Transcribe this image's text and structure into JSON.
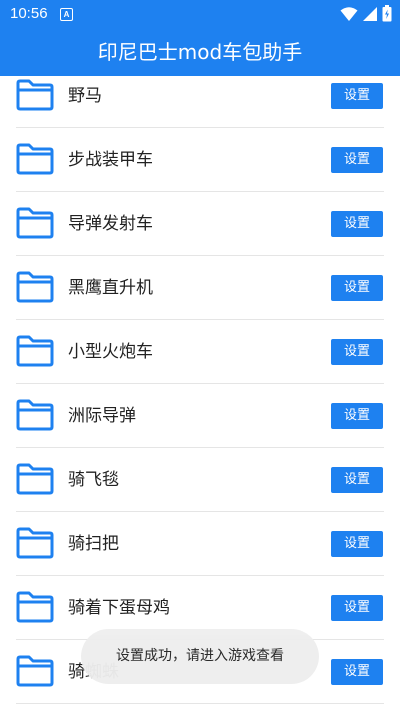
{
  "status_bar": {
    "time": "10:56",
    "notification_icon": "A"
  },
  "app": {
    "title": "印尼巴士mod车包助手"
  },
  "list": {
    "items": [
      {
        "label": "野马",
        "button": "设置"
      },
      {
        "label": "步战装甲车",
        "button": "设置"
      },
      {
        "label": "导弹发射车",
        "button": "设置"
      },
      {
        "label": "黑鹰直升机",
        "button": "设置"
      },
      {
        "label": "小型火炮车",
        "button": "设置"
      },
      {
        "label": "洲际导弹",
        "button": "设置"
      },
      {
        "label": "骑飞毯",
        "button": "设置"
      },
      {
        "label": "骑扫把",
        "button": "设置"
      },
      {
        "label": "骑着下蛋母鸡",
        "button": "设置"
      },
      {
        "label": "骑蜘蛛",
        "button": "设置"
      }
    ]
  },
  "toast": {
    "message": "设置成功，请进入游戏查看"
  },
  "colors": {
    "primary": "#1e81f0",
    "folder_icon": "#1e81f0",
    "divider": "#e5e5e5",
    "text": "#222222"
  },
  "icons": [
    "wifi-icon",
    "signal-icon",
    "battery-icon",
    "folder-icon",
    "notification-icon"
  ]
}
